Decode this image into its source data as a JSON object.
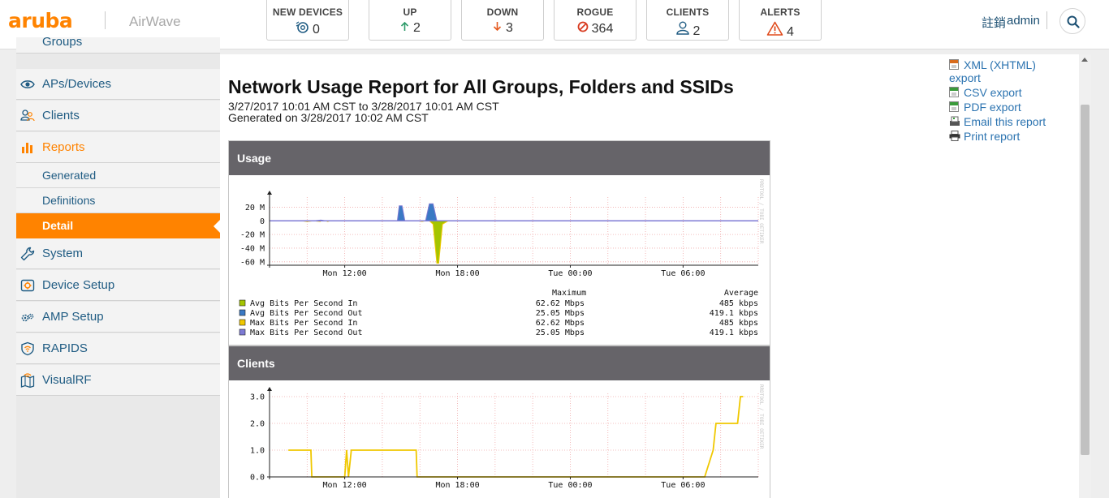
{
  "header": {
    "logo": "aruba",
    "product": "AirWave",
    "stats": [
      {
        "label": "NEW DEVICES",
        "value": "0",
        "icon": "new-devices-icon"
      },
      {
        "label": "UP",
        "value": "2",
        "icon": "arrow-up-icon",
        "color": "#2e9b6a"
      },
      {
        "label": "DOWN",
        "value": "3",
        "icon": "arrow-down-icon",
        "color": "#e4591e"
      },
      {
        "label": "ROGUE",
        "value": "364",
        "icon": "rogue-icon",
        "color": "#d83a1f"
      },
      {
        "label": "CLIENTS",
        "value": "2",
        "icon": "clients-icon"
      },
      {
        "label": "ALERTS",
        "value": "4",
        "icon": "alert-icon",
        "color": "#e04b1c"
      }
    ],
    "user_icon_text": "註銷",
    "user": "admin"
  },
  "sidebar": {
    "partial_top": "Groups",
    "items": [
      {
        "label": "APs/Devices",
        "icon": "eye-icon"
      },
      {
        "label": "Clients",
        "icon": "clients-icon"
      },
      {
        "label": "Reports",
        "icon": "bar-chart-icon"
      },
      {
        "label": "System",
        "icon": "wrench-icon"
      },
      {
        "label": "Device Setup",
        "icon": "device-setup-icon"
      },
      {
        "label": "AMP Setup",
        "icon": "gears-icon"
      },
      {
        "label": "RAPIDS",
        "icon": "shield-icon"
      },
      {
        "label": "VisualRF",
        "icon": "map-icon"
      }
    ],
    "reports_sub": [
      {
        "label": "Generated"
      },
      {
        "label": "Definitions"
      },
      {
        "label": "Detail"
      }
    ]
  },
  "report": {
    "title": "Network Usage Report for All Groups, Folders and SSIDs",
    "range": "3/27/2017 10:01 AM CST to 3/28/2017 10:01 AM CST",
    "generated": "Generated on 3/28/2017 10:02 AM CST"
  },
  "exports": [
    {
      "label": "XML (XHTML) export",
      "line1": "XML (XHTML)",
      "line2": "export",
      "icon": "xml-export-icon"
    },
    {
      "label": "CSV export",
      "icon": "csv-export-icon"
    },
    {
      "label": "PDF export",
      "icon": "pdf-export-icon"
    },
    {
      "label": "Email this report",
      "icon": "email-icon"
    },
    {
      "label": "Print report",
      "icon": "printer-icon"
    }
  ],
  "panels": {
    "usage_title": "Usage",
    "clients_title": "Clients",
    "watermark": "RRDTOOL / TOBI OETIKER",
    "legend_head": {
      "max": "Maximum",
      "avg": "Average"
    },
    "legend": [
      {
        "name": "Avg Bits Per Second In",
        "max": "62.62 Mbps",
        "avg": "485 kbps",
        "color": "#a4c400"
      },
      {
        "name": "Avg Bits Per Second Out",
        "max": "25.05 Mbps",
        "avg": "419.1 kbps",
        "color": "#3a79c4"
      },
      {
        "name": "Max Bits Per Second In",
        "max": "62.62 Mbps",
        "avg": "485 kbps",
        "color": "#f0c800"
      },
      {
        "name": "Max Bits Per Second Out",
        "max": "25.05 Mbps",
        "avg": "419.1 kbps",
        "color": "#7d7ad4"
      }
    ]
  },
  "chart_data": [
    {
      "type": "area",
      "title": "Usage",
      "x_ticks": [
        "Mon 12:00",
        "Mon 18:00",
        "Tue 00:00",
        "Tue 06:00"
      ],
      "y_ticks": [
        "20 M",
        "0",
        "-20 M",
        "-40 M",
        "-60 M"
      ],
      "ylim": [
        -65,
        30
      ],
      "grid": true,
      "x_hours": [
        9.7,
        10.0,
        10.35,
        10.7,
        10.75,
        11.0,
        11.1,
        11.2,
        11.6,
        14.8,
        14.9,
        15.05,
        15.2,
        16.0,
        16.1,
        16.3,
        16.5,
        16.7,
        16.9,
        17.0,
        17.2,
        17.5,
        34.0
      ],
      "series": [
        {
          "name": "Avg Bits Per Second In",
          "values": [
            0,
            -1,
            0,
            -1,
            0,
            0,
            -1,
            0,
            0,
            0,
            0,
            0,
            0,
            0,
            -1,
            0,
            0,
            -5,
            -62,
            -62,
            -5,
            0,
            0
          ]
        },
        {
          "name": "Avg Bits Per Second Out",
          "values": [
            0,
            0,
            0,
            1,
            1,
            0,
            0,
            0,
            0,
            0,
            22,
            22,
            0,
            0,
            0,
            0,
            25,
            25,
            0,
            0,
            0,
            0,
            0
          ]
        }
      ]
    },
    {
      "type": "line",
      "title": "Clients",
      "x_ticks": [
        "Mon 12:00",
        "Mon 18:00",
        "Tue 00:00",
        "Tue 06:00"
      ],
      "y_ticks": [
        "3.0",
        "2.0",
        "1.0",
        "0.0"
      ],
      "ylim": [
        0,
        3
      ],
      "grid": true,
      "x_hours": [
        9.0,
        10.2,
        10.25,
        10.9,
        12.0,
        12.1,
        12.2,
        12.35,
        12.4,
        15.8,
        15.85,
        31.0,
        31.15,
        31.6,
        31.75,
        32.0,
        32.9,
        33.05,
        33.2
      ],
      "series": [
        {
          "name": "",
          "values": [
            1,
            1,
            0,
            0,
            0,
            1,
            0,
            1,
            1,
            1,
            0,
            0,
            0,
            1,
            2,
            2,
            2,
            3,
            3
          ]
        }
      ]
    }
  ]
}
